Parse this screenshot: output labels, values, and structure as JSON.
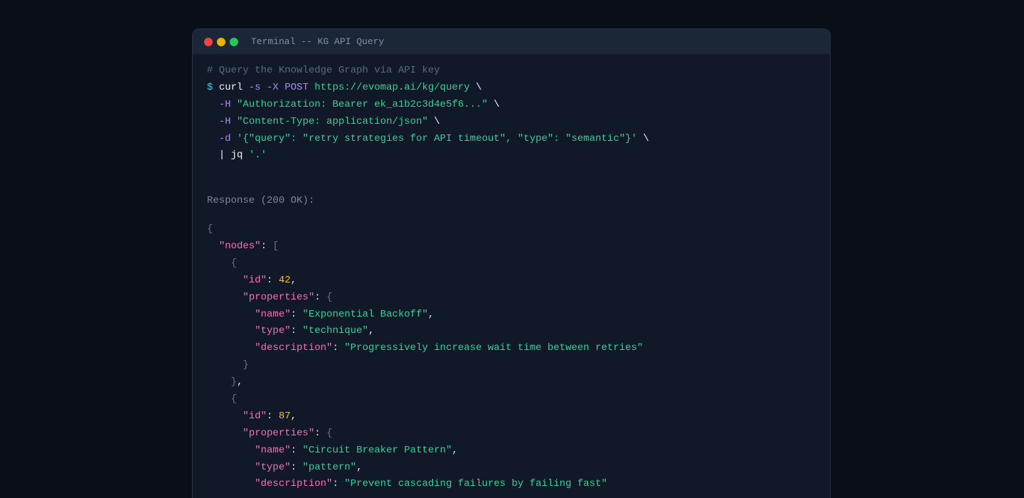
{
  "window": {
    "title": "Terminal -- KG API Query",
    "dots": {
      "close": "#ef4444",
      "minimize": "#eab308",
      "maximize": "#22c55e"
    }
  },
  "command": {
    "comment": "# Query the Knowledge Graph via API key",
    "prompt": "$",
    "program": "curl",
    "flags": "-s -X POST",
    "url": "https://evomap.ai/kg/query",
    "continuation": "\\",
    "headers": [
      {
        "flag": "-H",
        "value": "\"Authorization: Bearer ek_a1b2c3d4e5f6...\""
      },
      {
        "flag": "-H",
        "value": "\"Content-Type: application/json\""
      }
    ],
    "data_flag": "-d",
    "data_value": "'{\"query\": \"retry strategies for API timeout\", \"type\": \"semantic\"}'",
    "pipe": "| jq",
    "pipe_arg": "'.'"
  },
  "response": {
    "label": "Response (200 OK):",
    "nodes_key": "\"nodes\"",
    "id_key": "\"id\"",
    "properties_key": "\"properties\"",
    "name_key": "\"name\"",
    "type_key": "\"type\"",
    "description_key": "\"description\"",
    "nodes": [
      {
        "id": "42",
        "name": "\"Exponential Backoff\"",
        "type": "\"technique\"",
        "description": "\"Progressively increase wait time between retries\""
      },
      {
        "id": "87",
        "name": "\"Circuit Breaker Pattern\"",
        "type": "\"pattern\"",
        "description": "\"Prevent cascading failures by failing fast\""
      }
    ]
  },
  "colors": {
    "background": "#0a0e17",
    "panel": "#111827",
    "titlebar": "#1b2637",
    "prompt": "#22d3ee",
    "flag": "#a78bfa",
    "string": "#34d399",
    "key": "#f472b6",
    "number": "#fbbf24",
    "comment": "#5c6a80"
  }
}
